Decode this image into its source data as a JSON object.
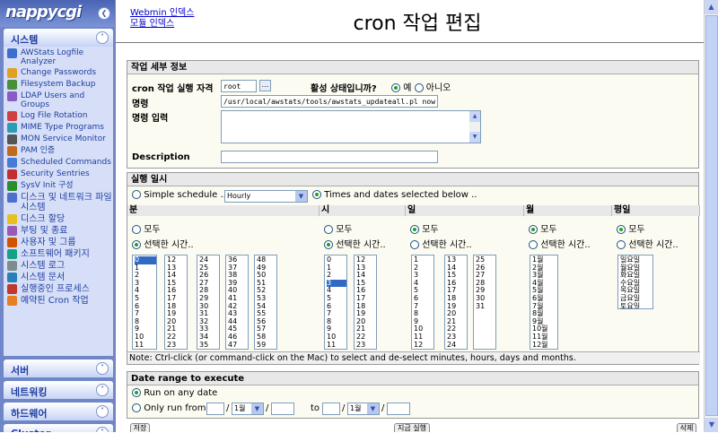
{
  "logo": "nappycgi",
  "sidebar": {
    "system_group": "시스템",
    "modules": [
      "AWStats Logfile Analyzer",
      "Change Passwords",
      "Filesystem Backup",
      "LDAP Users and Groups",
      "Log File Rotation",
      "MIME Type Programs",
      "MON Service Monitor",
      "PAM 인증",
      "Scheduled Commands",
      "Security Sentries",
      "SysV Init 구성",
      "디스크 및 네트워크 파일시스템",
      "디스크 할당",
      "부팅 및 종료",
      "사용자 및 그룹",
      "소프트웨어 패키지",
      "시스템 로그",
      "시스템 문서",
      "실행중인 프로세스",
      "예약된 Cron 작업"
    ],
    "other_groups": [
      "서버",
      "네트워킹",
      "하드웨어",
      "Cluster"
    ]
  },
  "top_links": [
    "Webmin 인덱스",
    "모듈 인덱스"
  ],
  "title": "cron 작업 편집",
  "details": {
    "header": "작업 세부 정보",
    "run_as_label": "cron 작업 실행 자격",
    "run_as_value": "root",
    "active_label": "활성 상태입니까?",
    "yes": "예",
    "no": "아니오",
    "command_label": "명령",
    "command_value": "/usr/local/awstats/tools/awstats_updateall.pl now >/dev/null",
    "input_label": "명령 입력",
    "desc_label": "Description",
    "desc_value": ""
  },
  "schedule": {
    "header": "실행 일시",
    "simple_label": "Simple schedule ..",
    "simple_value": "Hourly",
    "times_label": "Times and dates selected below ..",
    "cols": [
      "분",
      "시",
      "일",
      "월",
      "평일"
    ],
    "all": "모두",
    "selected": "선택한 시간..",
    "minutes": [
      [
        "0",
        "1",
        "2",
        "3",
        "4",
        "5",
        "6",
        "7",
        "8",
        "9",
        "10",
        "11"
      ],
      [
        "12",
        "13",
        "14",
        "15",
        "16",
        "17",
        "18",
        "19",
        "20",
        "21",
        "22",
        "23"
      ],
      [
        "24",
        "25",
        "26",
        "27",
        "28",
        "29",
        "30",
        "31",
        "32",
        "33",
        "34",
        "35"
      ],
      [
        "36",
        "37",
        "38",
        "39",
        "40",
        "41",
        "42",
        "43",
        "44",
        "45",
        "46",
        "47"
      ],
      [
        "48",
        "49",
        "50",
        "51",
        "52",
        "53",
        "54",
        "55",
        "56",
        "57",
        "58",
        "59"
      ]
    ],
    "hours": [
      [
        "0",
        "1",
        "2",
        "3",
        "4",
        "5",
        "6",
        "7",
        "8",
        "9",
        "10",
        "11"
      ],
      [
        "12",
        "13",
        "14",
        "15",
        "16",
        "17",
        "18",
        "19",
        "20",
        "21",
        "22",
        "23"
      ]
    ],
    "days": [
      [
        "1",
        "2",
        "3",
        "4",
        "5",
        "6",
        "7",
        "8",
        "9",
        "10",
        "11",
        "12"
      ],
      [
        "13",
        "14",
        "15",
        "16",
        "17",
        "18",
        "19",
        "20",
        "21",
        "22",
        "23",
        "24"
      ],
      [
        "25",
        "26",
        "27",
        "28",
        "29",
        "30",
        "31"
      ]
    ],
    "months": [
      "1월",
      "2월",
      "3월",
      "4월",
      "5월",
      "6월",
      "7월",
      "8월",
      "9월",
      "10월",
      "11월",
      "12월"
    ],
    "weekdays": [
      "일요일",
      "월요일",
      "화요일",
      "수요일",
      "목요일",
      "금요일",
      "토요일"
    ],
    "note": "Note: Ctrl-click (or command-click on the Mac) to select and de-select minutes, hours, days and months."
  },
  "range": {
    "header": "Date range to execute",
    "any": "Run on any date",
    "only": "Only run from",
    "month": "1월",
    "to": "to"
  },
  "buttons": {
    "save": "저장",
    "run": "지금 실행",
    "delete": "삭제"
  }
}
